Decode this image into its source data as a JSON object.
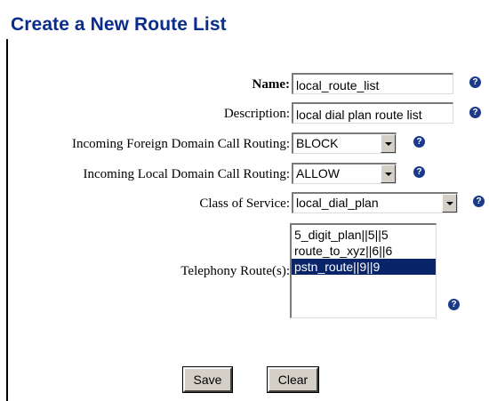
{
  "page": {
    "title": "Create a New Route List"
  },
  "form": {
    "name": {
      "label": "Name:",
      "value": "local_route_list"
    },
    "description": {
      "label": "Description:",
      "value": "local dial plan route list"
    },
    "foreign_routing": {
      "label": "Incoming Foreign Domain Call Routing:",
      "value": "BLOCK"
    },
    "local_routing": {
      "label": "Incoming Local Domain Call Routing:",
      "value": "ALLOW"
    },
    "class_of_service": {
      "label": "Class of Service:",
      "value": "local_dial_plan"
    },
    "telephony_routes": {
      "label": "Telephony Route(s):",
      "options": [
        "5_digit_plan||5||5",
        "route_to_xyz||6||6",
        "pstn_route||9||9"
      ],
      "selected": "pstn_route||9||9"
    }
  },
  "help_icon": {
    "glyph": "?",
    "icon": "help-icon",
    "color": "#1b3a8c"
  },
  "buttons": {
    "save": "Save",
    "clear": "Clear"
  },
  "colors": {
    "title": "#0a2c8a",
    "selection": "#0a246a",
    "button_face": "#d4d0c8"
  }
}
